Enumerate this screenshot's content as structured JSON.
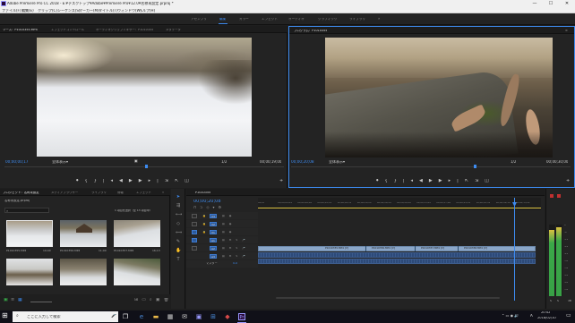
{
  "window": {
    "title": "Adobe Premiere Pro CC 2018 - E:¥デスクトップ¥Adobe¥Premiere Pro¥12.0¥名称未設定.prproj *",
    "controls": [
      "—",
      "☐",
      "✕"
    ]
  },
  "menu": [
    "ファイル(F)",
    "編集(E)",
    "クリップ(C)",
    "シーケンス(S)",
    "マーカー(M)",
    "タイトル(T)",
    "ウィンドウ(W)",
    "ヘルプ(H)"
  ],
  "workspaces": [
    {
      "label": "アセンブリ",
      "active": false
    },
    {
      "label": "編集",
      "active": true
    },
    {
      "label": "カラー",
      "active": false
    },
    {
      "label": "エフェクト",
      "active": false
    },
    {
      "label": "オーディオ",
      "active": false
    },
    {
      "label": "グラフィック",
      "active": false
    },
    {
      "label": "ライブラリ",
      "active": false
    }
  ],
  "source": {
    "tabs": [
      "ソース：P1010355.MP4",
      "エフェクトコントロール",
      "オーディオクリップミキサー：P1010355",
      "メタデータ"
    ],
    "timecode": "00;00;00;17",
    "fit": "全体表示",
    "quality": "1/2",
    "duration": "00;00;19;00"
  },
  "program": {
    "tabs": [
      "プログラム：P1010355"
    ],
    "timecode": "00;00;20;08",
    "fit": "全体表示",
    "quality": "1/2",
    "duration": "00;00;30;00"
  },
  "project": {
    "tabs": [
      "プロジェクト：名称未設定",
      "メディアブラウザー",
      "ライブラリ",
      "情報",
      "エフェクト"
    ],
    "name": "名称未設定.prproj",
    "count": "1 項目を選択（全 13 項目中）",
    "thumbs": [
      {
        "name": "P1010355.MP4",
        "dur": "19;00"
      },
      {
        "name": "P1010356.MP4",
        "dur": "11;00"
      },
      {
        "name": "P1010357.MP4",
        "dur": "16;13"
      },
      {
        "name": "",
        "dur": ""
      },
      {
        "name": "",
        "dur": ""
      },
      {
        "name": "",
        "dur": ""
      }
    ]
  },
  "timeline": {
    "tab": "P1010355",
    "timecode": "00;00;20;08",
    "ruler": [
      "00;00",
      "00;00;04;04",
      "00;00;08;08",
      "00;00;12;12",
      "00;00;16;16",
      "00;00;20;20",
      "00;00;24;24",
      "00;00;28;28",
      "00;00;33;02",
      "00;00;37;06",
      "00;00;41;10",
      "00;00;45;14",
      "00;00;49;18",
      "00;00;53;22"
    ],
    "tracks_v": [
      "V3",
      "V2",
      "V1"
    ],
    "tracks_a": [
      "A1",
      "A2",
      "A3"
    ],
    "master": "マスター",
    "master_val": "0.0",
    "clips": [
      "P1010355.MP4 [V]",
      "P1010356.MP4 [V]",
      "P1010357.MP4 [V]",
      "P1010358.MP4 [V]"
    ],
    "playhead_pct": 0.95
  },
  "meter": {
    "scale": [
      "0",
      "-6",
      "-12",
      "-18",
      "-24",
      "-30",
      "-36",
      "-42",
      "-48",
      "-54"
    ],
    "unit": "dB",
    "channels": [
      "S",
      "S"
    ]
  },
  "taskbar": {
    "search_placeholder": "ここに入力して検索",
    "time": "20:42",
    "date": "2018/02/10",
    "ime": "A"
  }
}
